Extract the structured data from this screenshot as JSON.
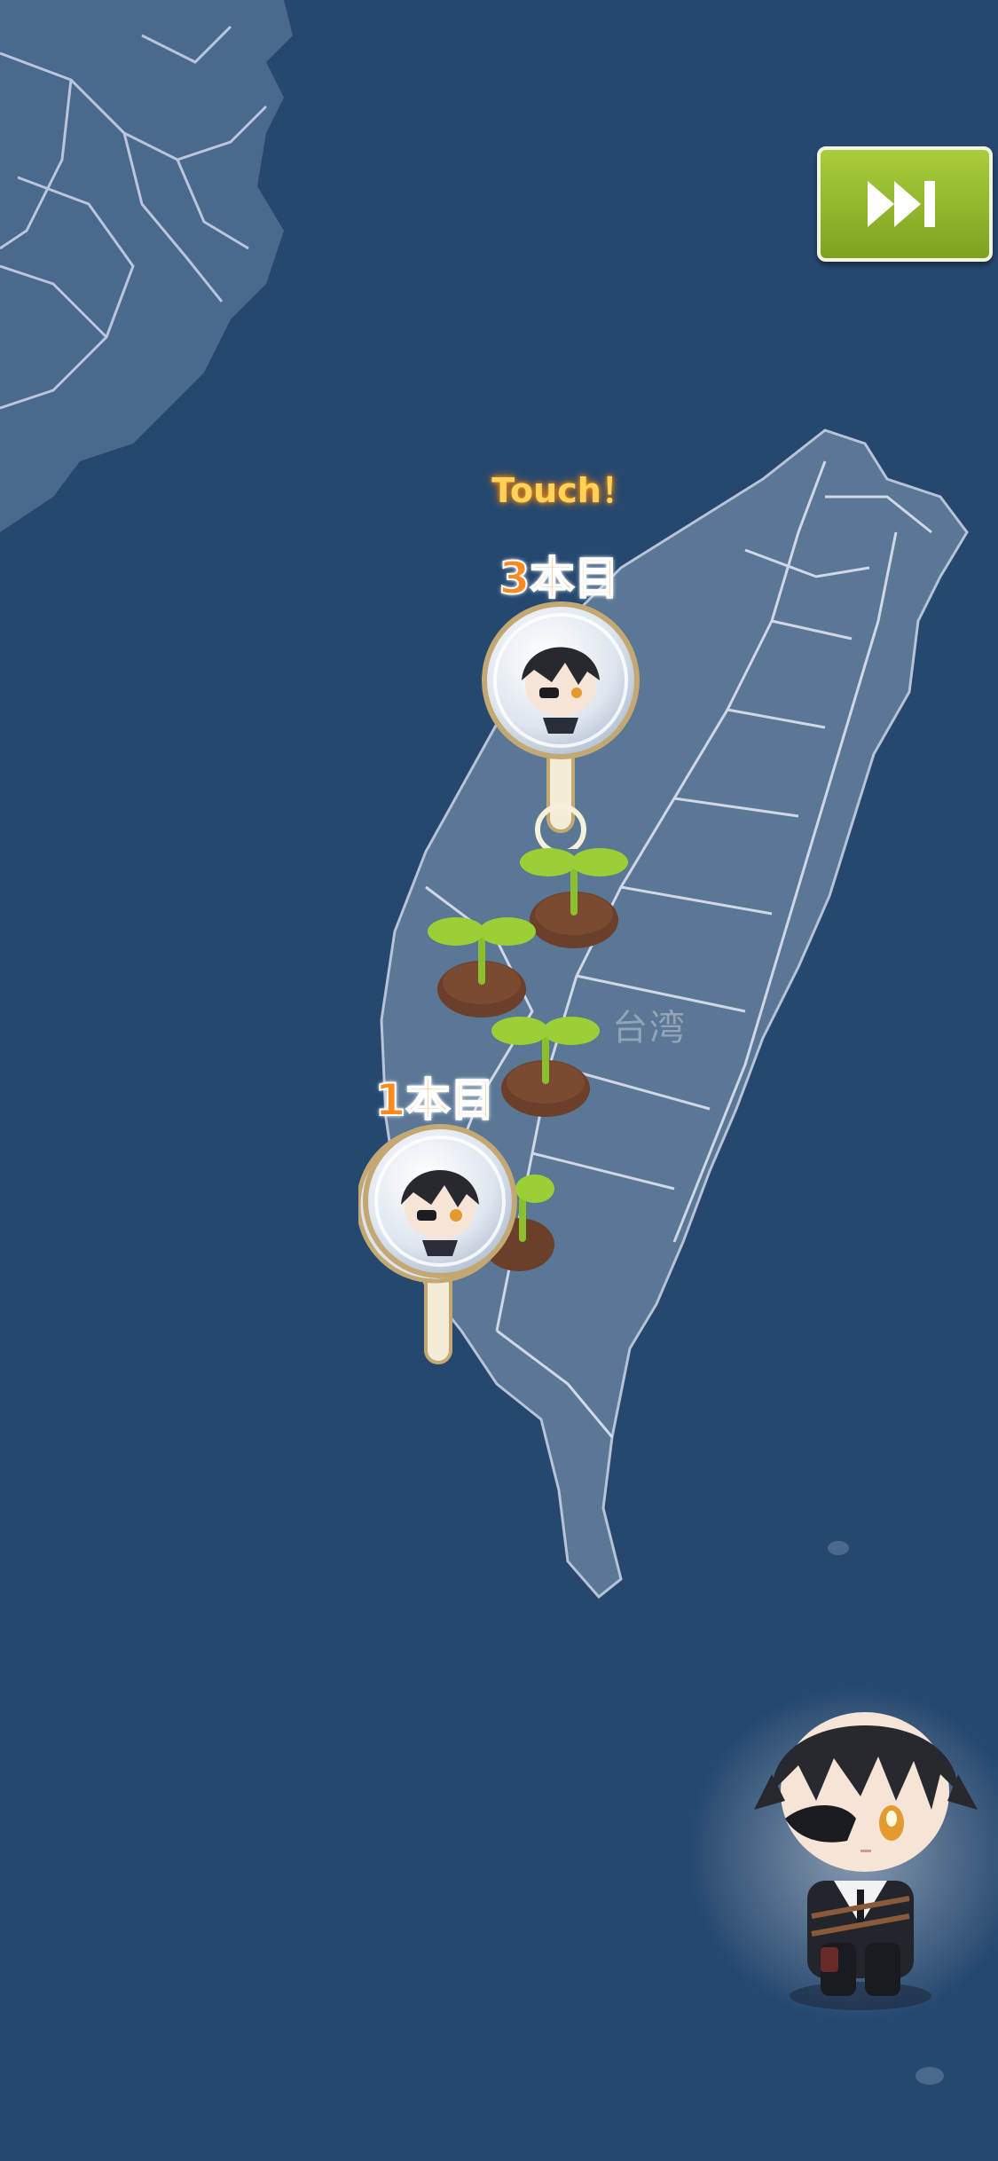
{
  "map": {
    "place_label": "台湾",
    "colors": {
      "sea": "#26486f",
      "land": "#5a7795",
      "roads": "#d9dcef"
    }
  },
  "controls": {
    "skip_icon": "fast-forward-end-icon",
    "touch_hint": "Touch！"
  },
  "markers": [
    {
      "label": "3本目",
      "character": "eyepatch-character-chibi"
    },
    {
      "label": "1本目",
      "character": "eyepatch-character-chibi"
    }
  ],
  "sprouts": {
    "count": 4,
    "icon": "sprout-icon"
  },
  "mascot": {
    "character": "eyepatch-character-chibi"
  }
}
